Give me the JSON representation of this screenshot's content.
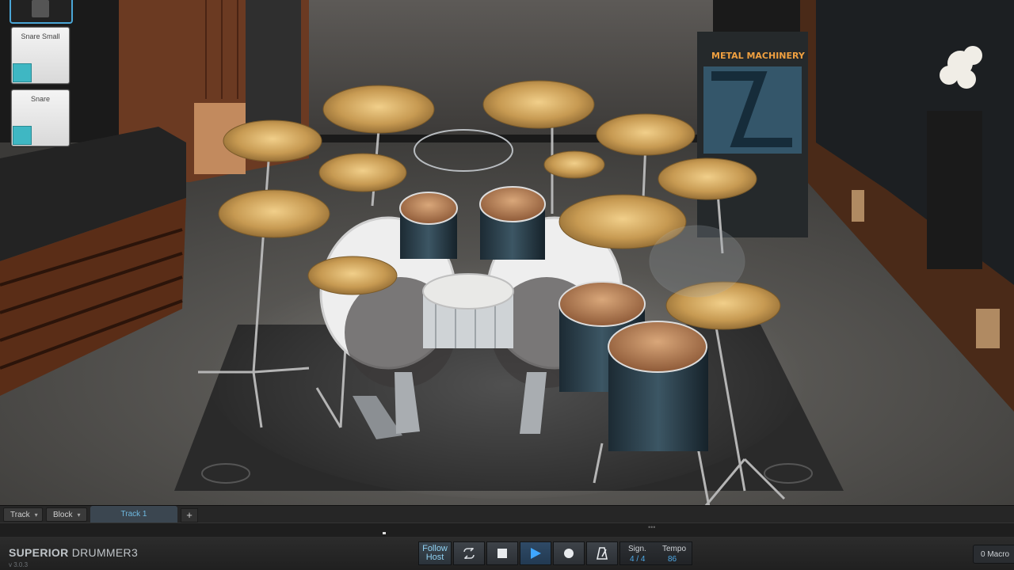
{
  "pads": {
    "top_pad": {
      "label": ""
    },
    "items": [
      {
        "label": "Snare Small",
        "swatch_color": "#3fb7c3"
      },
      {
        "label": "Snare",
        "swatch_color": "#3fb7c3"
      }
    ]
  },
  "banner": {
    "title": "METAL MACHINERY"
  },
  "track_bar": {
    "track_label": "Track",
    "block_label": "Block",
    "active_tab": "Track 1",
    "add_label": "+"
  },
  "transport": {
    "brand_part1": "SUPERIOR",
    "brand_part2": "DRUMMER",
    "brand_num": "3",
    "version": "v 3.0.3",
    "follow_line1": "Follow",
    "follow_line2": "Host",
    "sign_label": "Sign.",
    "sign_value": "4 / 4",
    "tempo_label": "Tempo",
    "tempo_value": "86",
    "macro_label": "0  Macro"
  },
  "colors": {
    "accent": "#3fa7ff",
    "pad_swatch": "#3fb7c3",
    "tab_text": "#6fb9e0"
  }
}
